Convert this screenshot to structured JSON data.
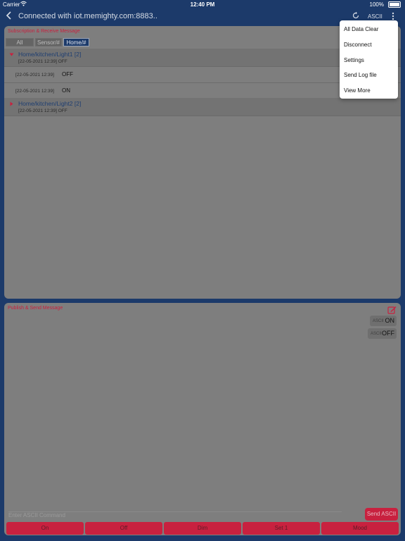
{
  "status_bar": {
    "carrier": "Carrier",
    "time": "12:40 PM",
    "battery": "100%"
  },
  "nav": {
    "back_icon": "chevron-left-icon",
    "title": "Connected with iot.memighty.com:8883..",
    "refresh_icon": "refresh-icon",
    "mode_label": "ASCII",
    "more_icon": "more-vertical-icon"
  },
  "subscription": {
    "title": "Subscription & Receive Message",
    "filters": [
      "All",
      "Sensor/#",
      "Home/#"
    ],
    "active_filter": "Home/#",
    "groups": [
      {
        "topic": "Home/kitchen/Light1 [2]",
        "meta": "[22-05-2021 12:39]  OFF",
        "expanded": true,
        "messages": [
          {
            "timestamp": "[22-05-2021 12:39]",
            "value": "OFF"
          },
          {
            "timestamp": "[22-05-2021 12:39]",
            "value": "ON"
          }
        ]
      },
      {
        "topic": "Home/kitchen/Light2 [2]",
        "meta": "[22-05-2021 12:39]  OFF",
        "expanded": false,
        "messages": []
      }
    ]
  },
  "publish": {
    "title": "Publish & Send Message",
    "edit_icon": "edit-icon",
    "sent": [
      {
        "encoding": "ASCII",
        "value": "ON"
      },
      {
        "encoding": "ASCII",
        "value": "OFF"
      }
    ],
    "input_placeholder": "Enter ASCII Command",
    "send_label": "Send ASCII",
    "quick_buttons": [
      "On",
      "Off",
      "Dim",
      "Set 1",
      "Mood"
    ]
  },
  "menu": {
    "items": [
      "All Data Clear",
      "Disconnect",
      "Settings",
      "Send Log file",
      "View More"
    ]
  },
  "colors": {
    "nav_bg": "#1c3a6a",
    "accent": "#c8213f",
    "panel_bg": "#7e7e7e",
    "menu_bg": "#ffffff"
  }
}
